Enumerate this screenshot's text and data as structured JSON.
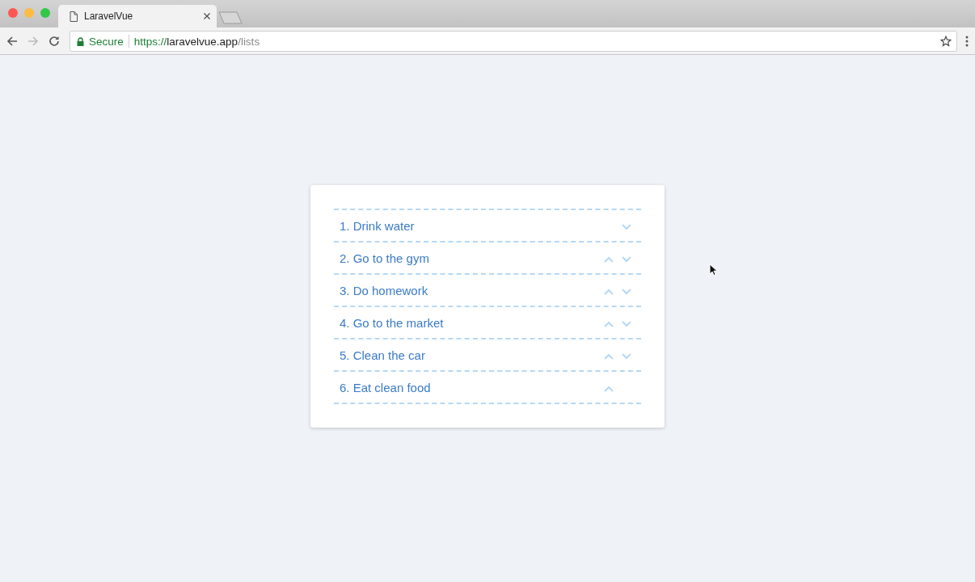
{
  "browser": {
    "tab": {
      "title": "LaravelVue",
      "selected": true
    },
    "address": {
      "secure_label": "Secure",
      "scheme": "https://",
      "host": "laravelvue.app",
      "path": "/lists"
    }
  },
  "list": {
    "items": [
      {
        "text": "1. Drink water",
        "can_move_up": false,
        "can_move_down": true
      },
      {
        "text": "2. Go to the gym",
        "can_move_up": true,
        "can_move_down": true
      },
      {
        "text": "3. Do homework",
        "can_move_up": true,
        "can_move_down": true
      },
      {
        "text": "4. Go to the market",
        "can_move_up": true,
        "can_move_down": true
      },
      {
        "text": "5. Clean the car",
        "can_move_up": true,
        "can_move_down": true
      },
      {
        "text": "6. Eat clean food",
        "can_move_up": true,
        "can_move_down": false
      }
    ]
  }
}
